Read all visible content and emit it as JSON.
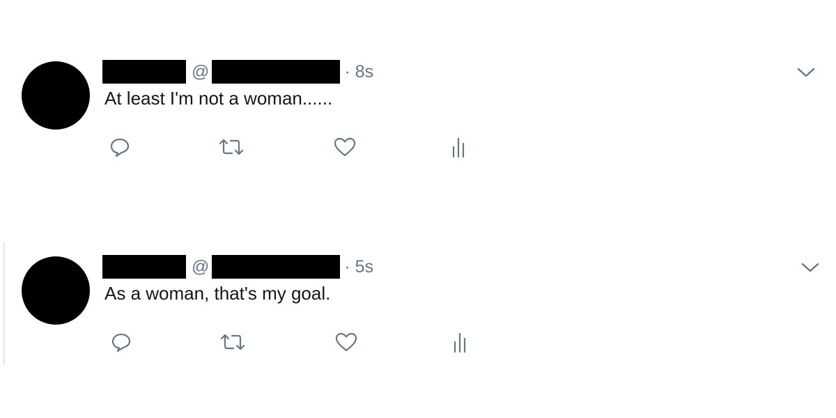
{
  "tweets": [
    {
      "at_sign": "@",
      "time": "· 8s",
      "text": "At least I'm not a woman......",
      "icons": {
        "reply": "reply-icon",
        "retweet": "retweet-icon",
        "like": "heart-icon",
        "analytics": "analytics-icon",
        "menu": "chevron-down-icon"
      }
    },
    {
      "at_sign": "@",
      "time": "· 5s",
      "text": "As a woman, that's my goal.",
      "icons": {
        "reply": "reply-icon",
        "retweet": "retweet-icon",
        "like": "heart-icon",
        "analytics": "analytics-icon",
        "menu": "chevron-down-icon"
      }
    }
  ],
  "colors": {
    "meta_text": "#657786",
    "body_text": "#14171a",
    "icon": "#657786",
    "thread_line": "#e6ecf0",
    "redaction": "#000000"
  }
}
